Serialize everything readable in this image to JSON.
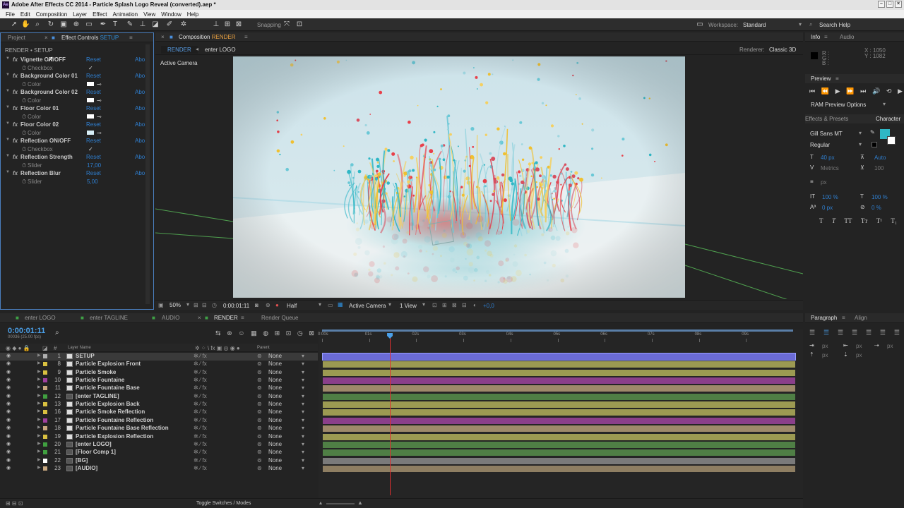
{
  "app": {
    "title": "Adobe After Effects CC 2014 - Particle Splash Logo Reveal (converted).aep *",
    "icon": "Ae"
  },
  "menu": [
    "File",
    "Edit",
    "Composition",
    "Layer",
    "Effect",
    "Animation",
    "View",
    "Window",
    "Help"
  ],
  "toolbar": {
    "snapping": "Snapping",
    "workspace_label": "Workspace:",
    "workspace": "Standard",
    "search": "Search Help"
  },
  "left_panel": {
    "tabs": [
      "Project",
      "Effect Controls",
      "SETUP"
    ],
    "breadcrumb": "RENDER • SETUP",
    "effects": [
      {
        "name": "Vignette ON/OFF",
        "prop": "Checkbox",
        "value": "✓",
        "kind": "check"
      },
      {
        "name": "Background Color 01",
        "prop": "Color",
        "kind": "color",
        "color": "#ffffff"
      },
      {
        "name": "Background Color 02",
        "prop": "Color",
        "kind": "color",
        "color": "#ffffff"
      },
      {
        "name": "Floor Color 01",
        "prop": "Color",
        "kind": "color",
        "color": "#ffffff"
      },
      {
        "name": "Floor Color 02",
        "prop": "Color",
        "kind": "color",
        "color": "#d8eef6"
      },
      {
        "name": "Reflection ON/OFF",
        "prop": "Checkbox",
        "value": "✓",
        "kind": "check"
      },
      {
        "name": "Reflection Strength",
        "prop": "Slider",
        "value": "17,00",
        "kind": "slider"
      },
      {
        "name": "Reflection Blur",
        "prop": "Slider",
        "value": "5,00",
        "kind": "slider"
      }
    ],
    "reset": "Reset",
    "about": "Abo"
  },
  "comp_panel": {
    "tab_label": "Composition",
    "tab_name": "RENDER",
    "crumbs": [
      "RENDER",
      "enter LOGO"
    ],
    "renderer_label": "Renderer:",
    "renderer": "Classic 3D",
    "camera": "Active Camera",
    "footer": {
      "zoom": "50%",
      "time": "0:00:01:11",
      "resolution": "Half",
      "view": "Active Camera",
      "views": "1 View",
      "exposure": "+0,0"
    }
  },
  "right_panel": {
    "info_tab": "Info",
    "audio_tab": "Audio",
    "rgb": [
      "R :",
      "G :",
      "B :"
    ],
    "coords": [
      "X : 1050",
      "Y : 1082"
    ],
    "preview_tab": "Preview",
    "ram": "RAM Preview Options",
    "effects_presets": "Effects & Presets",
    "character": "Character",
    "font": "Gill Sans MT",
    "style": "Regular",
    "size": "40 px",
    "leading": "Auto",
    "metrics": "Metrics",
    "tracking": "100",
    "px": "px",
    "scale_v": "100 %",
    "scale_h": "100 %",
    "baseline": "0 px",
    "tsume": "0 %",
    "accent": "#2fb7c5"
  },
  "timeline": {
    "tabs": [
      "enter LOGO",
      "enter TAGLINE",
      "AUDIO",
      "RENDER",
      "Render Queue"
    ],
    "time": "0:00:01:11",
    "fps": "00036 (25.00 fps)",
    "col_layer": "Layer Name",
    "col_parent": "Parent",
    "toggle": "Toggle Switches / Modes",
    "ruler": [
      "0:00s",
      "01s",
      "02s",
      "03s",
      "04s",
      "05s",
      "06s",
      "07s",
      "08s",
      "09s"
    ],
    "playhead_seconds": 1.44,
    "duration_seconds": 10,
    "layers": [
      {
        "num": "1",
        "name": "SETUP",
        "label": "#b0b0b0",
        "bar": "#6b6bd6",
        "parent": "None",
        "sel": true
      },
      {
        "num": "8",
        "name": "Particle Explosion Front",
        "label": "#d8c040",
        "bar": "#9c9a52",
        "parent": "None"
      },
      {
        "num": "9",
        "name": "Particle Smoke",
        "label": "#d8c040",
        "bar": "#9c9a52",
        "parent": "None"
      },
      {
        "num": "10",
        "name": "Particle Fountaine",
        "label": "#a040a0",
        "bar": "#8a3f8a",
        "parent": "None"
      },
      {
        "num": "11",
        "name": "Particle Fountaine Base",
        "label": "#c8a880",
        "bar": "#9e8a6a",
        "parent": "None"
      },
      {
        "num": "12",
        "name": "[enter TAGLINE]",
        "label": "#40a040",
        "bar": "#4f7f45",
        "parent": "None"
      },
      {
        "num": "13",
        "name": "Particle Explosion Back",
        "label": "#d8c040",
        "bar": "#9c9a52",
        "parent": "None"
      },
      {
        "num": "16",
        "name": "Particle Smoke Reflection",
        "label": "#d8c040",
        "bar": "#9c9a52",
        "parent": "None"
      },
      {
        "num": "17",
        "name": "Particle Fountaine Reflection",
        "label": "#a040a0",
        "bar": "#8a3f8a",
        "parent": "None"
      },
      {
        "num": "18",
        "name": "Particle Fountaine Base Reflection",
        "label": "#c8a880",
        "bar": "#9e8a6a",
        "parent": "None"
      },
      {
        "num": "19",
        "name": "Particle Explosion Reflection",
        "label": "#d8c040",
        "bar": "#9c9a52",
        "parent": "None"
      },
      {
        "num": "20",
        "name": "[enter LOGO]",
        "label": "#40a040",
        "bar": "#4f7f45",
        "parent": "None"
      },
      {
        "num": "21",
        "name": "[Floor Comp 1]",
        "label": "#40a040",
        "bar": "#4f7f45",
        "parent": "None"
      },
      {
        "num": "22",
        "name": "[BG]",
        "label": "#ffffff",
        "bar": "#7a7a7a",
        "parent": "None"
      },
      {
        "num": "23",
        "name": "[AUDIO]",
        "label": "#c8a880",
        "bar": "#8e7e62",
        "parent": "None"
      }
    ]
  },
  "paragraph": {
    "tab": "Paragraph",
    "align_tab": "Align",
    "px": "px"
  }
}
